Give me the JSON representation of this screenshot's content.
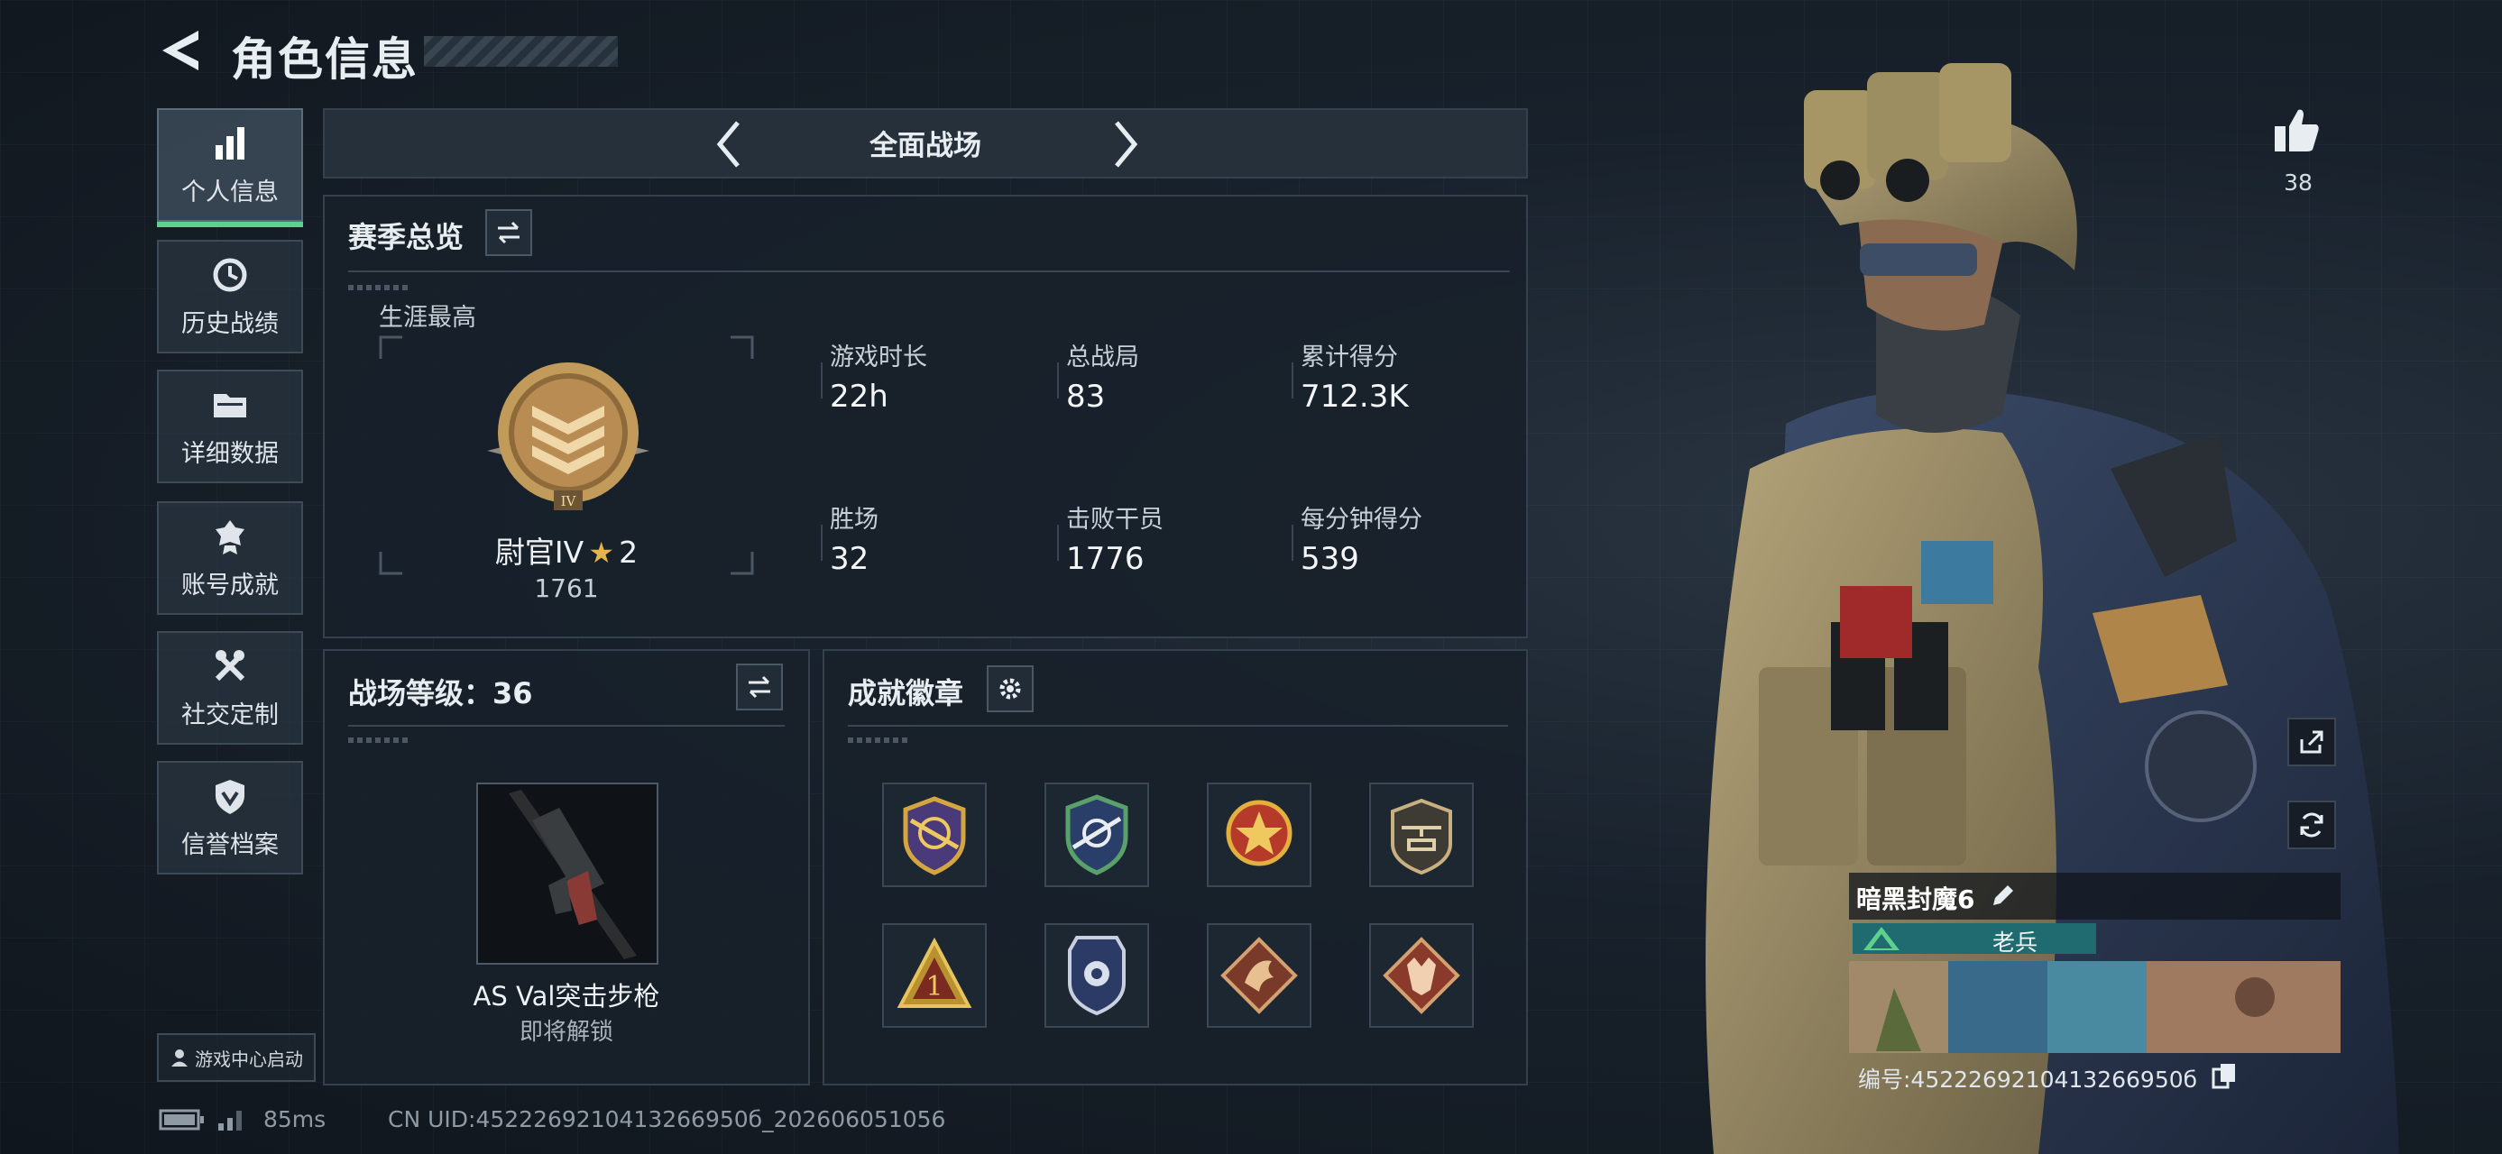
{
  "header": {
    "title": "角色信息"
  },
  "sidebar": {
    "items": [
      {
        "label": "个人信息",
        "icon": "bar-chart-icon",
        "active": true
      },
      {
        "label": "历史战绩",
        "icon": "history-icon"
      },
      {
        "label": "详细数据",
        "icon": "folder-icon"
      },
      {
        "label": "账号成就",
        "icon": "medal-icon"
      },
      {
        "label": "社交定制",
        "icon": "tools-icon"
      },
      {
        "label": "信誉档案",
        "icon": "shield-icon"
      }
    ],
    "launch_label": "游戏中心启动"
  },
  "mode": {
    "title": "全面战场"
  },
  "season": {
    "title": "赛季总览",
    "career_label": "生涯最高",
    "rank_name": "尉官IV",
    "rank_stars": "2",
    "rank_score": "1761",
    "stats": [
      {
        "label": "游戏时长",
        "value": "22h"
      },
      {
        "label": "总战局",
        "value": "83"
      },
      {
        "label": "累计得分",
        "value": "712.3K"
      },
      {
        "label": "胜场",
        "value": "32"
      },
      {
        "label": "击败干员",
        "value": "1776"
      },
      {
        "label": "每分钟得分",
        "value": "539"
      }
    ]
  },
  "battlefield": {
    "level_label": "战场等级：36",
    "weapon_name": "AS Val突击步枪",
    "weapon_status": "即将解锁"
  },
  "achievements": {
    "title": "成就徽章",
    "badges": [
      "badge-compass-icon",
      "badge-rifle-shield-icon",
      "badge-star-icon",
      "badge-helicopter-icon",
      "badge-rank-one-icon",
      "badge-police-icon",
      "badge-dragon-icon",
      "badge-wolf-icon"
    ]
  },
  "profile": {
    "likes": "38",
    "player_name": "暗黑封魔6",
    "tier_label": "老兵",
    "uid_label": "编号:4522269210413266950б"
  },
  "status": {
    "latency": "85ms",
    "uid": "CN UID:4522269210413266950б_202606051056"
  },
  "colors": {
    "accent_green": "#5ed18e",
    "panel_bg": "#18212a",
    "rank_teal": "#1f6b6f"
  }
}
